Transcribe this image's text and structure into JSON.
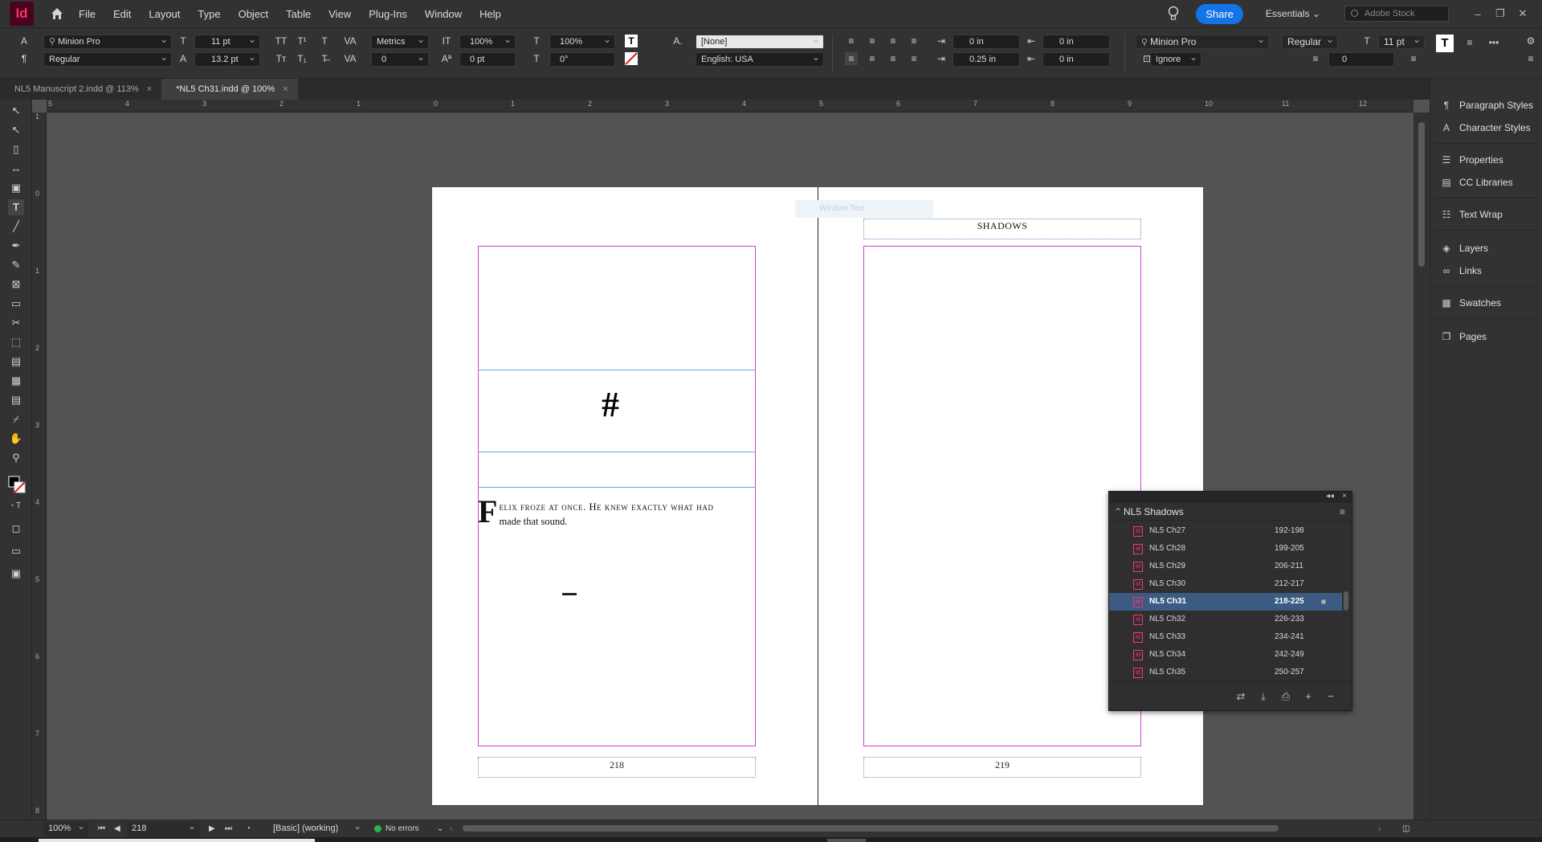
{
  "app": {
    "logo": "Id",
    "menus": [
      "File",
      "Edit",
      "Layout",
      "Type",
      "Object",
      "Table",
      "View",
      "Plug-Ins",
      "Window",
      "Help"
    ],
    "share_label": "Share",
    "workspace": "Essentials",
    "stock_placeholder": "Adobe Stock"
  },
  "control": {
    "font_family": "Minion Pro",
    "font_style": "Regular",
    "font_size": "11 pt",
    "leading": "13.2 pt",
    "kerning": "Metrics",
    "tracking": "0",
    "vscale": "100%",
    "hscale": "100%",
    "baseline_shift": "0 pt",
    "skew": "0°",
    "char_style": "[None]",
    "language": "English: USA",
    "left_indent": "0 in",
    "right_indent": "0 in",
    "first_line_indent": "0.25 in",
    "last_line_indent": "0 in",
    "space_before": "0 in",
    "space_after": "0 in",
    "para_font": "Minion Pro",
    "para_style": "Regular",
    "para_size": "11 pt",
    "hyphen_mode": "Ignore",
    "drop_cap_lines": "0"
  },
  "tabs": [
    {
      "label": "NL5 Manuscript 2.indd @ 113%",
      "close": "×"
    },
    {
      "label": "*NL5 Ch31.indd @ 100%",
      "close": "×"
    }
  ],
  "ruler": {
    "h_ticks": [
      "5",
      "4",
      "3",
      "2",
      "1",
      "0",
      "1",
      "2",
      "3",
      "4",
      "5",
      "6",
      "7",
      "8",
      "9",
      "10",
      "11",
      "12"
    ],
    "v_ticks": [
      "1",
      "0",
      "1",
      "2",
      "3",
      "4",
      "5",
      "6",
      "7",
      "8"
    ]
  },
  "spread": {
    "left_page_number": "218",
    "right_page_number": "219",
    "running_head": "SHADOWS",
    "ornament": "#",
    "drop_cap": "F",
    "body_smallcaps": "elix froze at once. He knew exactly what had",
    "body_rest": "made that sound.",
    "overlay_text": "Window Text"
  },
  "book_panel": {
    "title": "NL5 Shadows",
    "collapse_label": "◂◂",
    "close_label": "×",
    "menu_icon": "≡",
    "docs": [
      {
        "name": "NL5 Ch27",
        "range": "192-198"
      },
      {
        "name": "NL5 Ch28",
        "range": "199-205"
      },
      {
        "name": "NL5 Ch29",
        "range": "206-211"
      },
      {
        "name": "NL5 Ch30",
        "range": "212-217"
      },
      {
        "name": "NL5 Ch31",
        "range": "218-225",
        "selected": true,
        "open": true
      },
      {
        "name": "NL5 Ch32",
        "range": "226-233"
      },
      {
        "name": "NL5 Ch33",
        "range": "234-241"
      },
      {
        "name": "NL5 Ch34",
        "range": "242-249"
      },
      {
        "name": "NL5 Ch35",
        "range": "250-257"
      }
    ]
  },
  "dock": {
    "items": [
      "Paragraph Styles",
      "Character Styles",
      "Properties",
      "CC Libraries",
      "Text Wrap",
      "Layers",
      "Links",
      "Swatches",
      "Pages"
    ]
  },
  "status": {
    "zoom": "100%",
    "page": "218",
    "profile": "[Basic] (working)",
    "preflight": "No errors",
    "preflight_color": "#2fb34a"
  }
}
